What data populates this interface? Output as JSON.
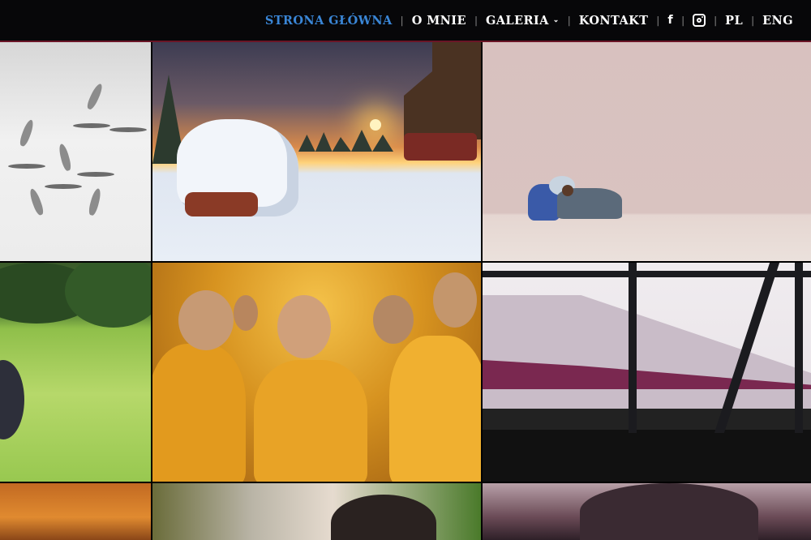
{
  "nav": {
    "home": "STRONA GŁÓWNA",
    "about": "O MNIE",
    "gallery": "GALERIA",
    "contact": "KONTAKT",
    "facebook_glyph": "f",
    "lang_pl": "PL",
    "lang_eng": "ENG",
    "separator": "|",
    "gallery_chevron": "⌄"
  },
  "colors": {
    "active_link": "#3a86d6",
    "header_bg": "#070709",
    "header_border": "#6a1526"
  },
  "icons": {
    "facebook": "facebook-icon",
    "instagram": "instagram-icon",
    "dropdown": "chevron-down-icon"
  },
  "gallery": {
    "tiles": [
      "birds-in-flight",
      "winter-sunset-cabin",
      "man-resting-by-pink-wall",
      "rice-field",
      "young-monks",
      "train-on-bridge",
      "sunset-field",
      "portrait-child",
      "trees-at-dusk"
    ]
  }
}
